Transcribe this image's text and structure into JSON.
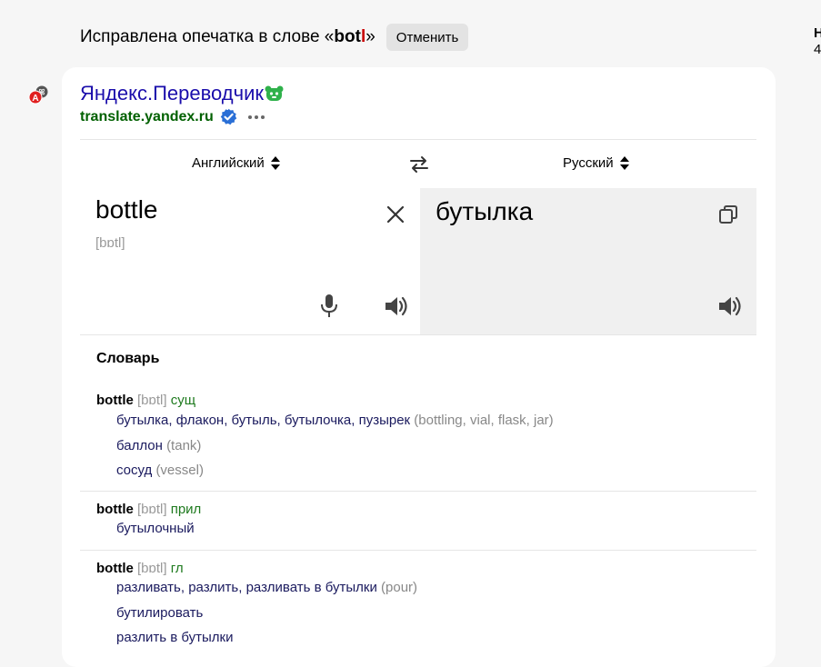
{
  "typo_bar": {
    "prefix": "Исправлена опечатка в слове «",
    "word_correct_part": "bot",
    "word_error_part": "l",
    "suffix": "»",
    "undo_label": "Отменить"
  },
  "right_cut": {
    "line1": "Н",
    "line2": "4"
  },
  "result": {
    "title": "Яндекс.Переводчик",
    "url": "translate.yandex.ru"
  },
  "translator": {
    "source_lang": "Английский",
    "target_lang": "Русский",
    "source_text": "bottle",
    "source_transcription": "[bɒtl]",
    "target_text": "бутылка"
  },
  "dictionary": {
    "title": "Словарь",
    "entries": [
      {
        "headword": "bottle",
        "transcription": "[bɒtl]",
        "pos": "сущ",
        "senses": [
          {
            "text": "бутылка, флакон, бутыль, бутылочка, пузырек",
            "gloss": "(bottling, vial, flask, jar)"
          },
          {
            "text": "баллон",
            "gloss": "(tank)"
          },
          {
            "text": "сосуд",
            "gloss": "(vessel)"
          }
        ]
      },
      {
        "headword": "bottle",
        "transcription": "[bɒtl]",
        "pos": "прил",
        "senses": [
          {
            "text": "бутылочный",
            "gloss": ""
          }
        ]
      },
      {
        "headword": "bottle",
        "transcription": "[bɒtl]",
        "pos": "гл",
        "senses": [
          {
            "text": "разливать, разлить, разливать в бутылки",
            "gloss": "(pour)"
          },
          {
            "text": "бутилировать",
            "gloss": ""
          },
          {
            "text": "разлить в бутылки",
            "gloss": ""
          }
        ]
      }
    ]
  },
  "colors": {
    "link": "#1a0dab",
    "url": "#006000",
    "pos": "#1e7a1e",
    "error": "#c80000",
    "verified": "#2a6fd6"
  },
  "icons": [
    "extension-badge-icon",
    "logo-icon",
    "verified-icon",
    "more-icon",
    "sort-arrows-icon",
    "swap-icon",
    "close-icon",
    "microphone-icon",
    "speaker-icon",
    "copy-icon"
  ]
}
